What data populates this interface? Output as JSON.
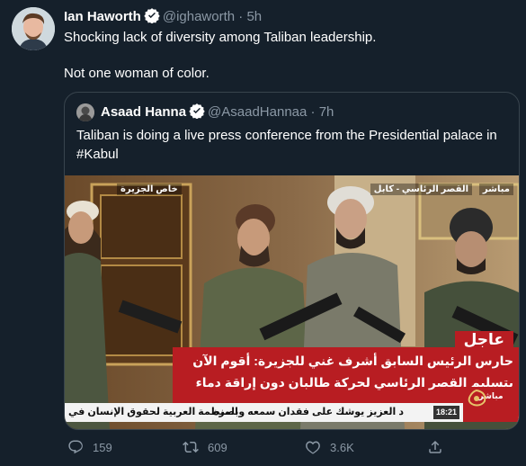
{
  "tweet": {
    "author_name": "Ian Haworth",
    "handle": "@ighaworth",
    "time": "5h",
    "text_line1": "Shocking lack of diversity among Taliban leadership.",
    "text_line2": "Not one woman of color."
  },
  "quoted": {
    "author_name": "Asaad Hanna",
    "handle": "@AsaadHannaa",
    "time": "7h",
    "text": "Taliban is doing a live press conference from the Presidential palace in #Kabul",
    "media": {
      "tag_left": "خاص الجزيرة",
      "tag_right_location": "القصر الرئاسي - كابل",
      "tag_right_live": "مباشر",
      "breaking_label": "عاجل",
      "breaking_line1": "حارس الرئيس السابق أشرف غني للجزيرة: أقوم الآن",
      "breaking_line2": "بتسليم القصر الرئاسي لحركة طالبان دون إراقة دماء",
      "ticker_time": "18:21",
      "ticker_text1": "د العزيز يوشك على فقدان سمعه وبصره",
      "ticker_text2": "المنظمة العربية لحقوق الإنسان في",
      "logo_live": "مباشر"
    }
  },
  "actions": {
    "replies": "159",
    "retweets": "609",
    "likes": "3.6K"
  },
  "colors": {
    "background": "#15202b",
    "muted": "#8b98a5",
    "border": "#38444d",
    "verified": "#1d9bf0",
    "breaking": "#b81d22"
  }
}
